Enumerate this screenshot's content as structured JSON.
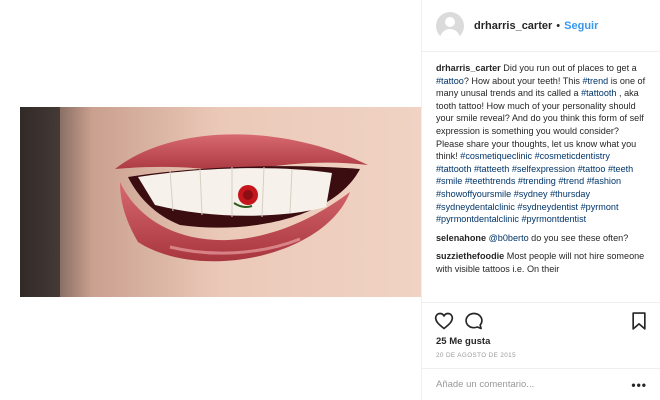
{
  "post": {
    "author": "drharris_carter",
    "separator": "•",
    "follow_label": "Seguir",
    "likes": "25 Me gusta",
    "date": "20 DE AGOSTO DE 2015",
    "comment_placeholder": "Añade un comentario...",
    "more_label": "•••"
  },
  "caption": {
    "user": "drharris_carter",
    "segments": [
      {
        "text": "Did you run out of places to get a ",
        "tag": false
      },
      {
        "text": "#tattoo",
        "tag": true
      },
      {
        "text": "? How about your teeth! This ",
        "tag": false
      },
      {
        "text": "#trend",
        "tag": true
      },
      {
        "text": " is one of many unusal trends and its called a ",
        "tag": false
      },
      {
        "text": "#tattooth",
        "tag": true
      },
      {
        "text": " , aka tooth tattoo! How much of your personality should your smile reveal? And do you think this form of self expression is something you would consider? Please share your thoughts, let us know what you think! ",
        "tag": false
      },
      {
        "text": "#cosmetiqueclinic",
        "tag": true
      },
      {
        "text": " ",
        "tag": false
      },
      {
        "text": "#cosmeticdentistry",
        "tag": true
      },
      {
        "text": " ",
        "tag": false
      },
      {
        "text": "#tattooth",
        "tag": true
      },
      {
        "text": " ",
        "tag": false
      },
      {
        "text": "#tatteeth",
        "tag": true
      },
      {
        "text": " ",
        "tag": false
      },
      {
        "text": "#selfexpression",
        "tag": true
      },
      {
        "text": " ",
        "tag": false
      },
      {
        "text": "#tattoo",
        "tag": true
      },
      {
        "text": " ",
        "tag": false
      },
      {
        "text": "#teeth",
        "tag": true
      },
      {
        "text": " ",
        "tag": false
      },
      {
        "text": "#smile",
        "tag": true
      },
      {
        "text": " ",
        "tag": false
      },
      {
        "text": "#teethtrends",
        "tag": true
      },
      {
        "text": " ",
        "tag": false
      },
      {
        "text": "#trending",
        "tag": true
      },
      {
        "text": " ",
        "tag": false
      },
      {
        "text": "#trend",
        "tag": true
      },
      {
        "text": " ",
        "tag": false
      },
      {
        "text": "#fashion",
        "tag": true
      },
      {
        "text": " ",
        "tag": false
      },
      {
        "text": "#showoffyoursmile",
        "tag": true
      },
      {
        "text": " ",
        "tag": false
      },
      {
        "text": "#sydney",
        "tag": true
      },
      {
        "text": " ",
        "tag": false
      },
      {
        "text": "#thursday",
        "tag": true
      },
      {
        "text": " ",
        "tag": false
      },
      {
        "text": "#sydneydentalclinic",
        "tag": true
      },
      {
        "text": " ",
        "tag": false
      },
      {
        "text": "#sydneydentist",
        "tag": true
      },
      {
        "text": " ",
        "tag": false
      },
      {
        "text": "#pyrmont",
        "tag": true
      },
      {
        "text": " ",
        "tag": false
      },
      {
        "text": "#pyrmontdentalclinic",
        "tag": true
      },
      {
        "text": " ",
        "tag": false
      },
      {
        "text": "#pyrmontdentist",
        "tag": true
      }
    ]
  },
  "comments": [
    {
      "user": "selenahone",
      "segments": [
        {
          "text": "@b0berto",
          "tag": true
        },
        {
          "text": " do you see these often?",
          "tag": false
        }
      ]
    },
    {
      "user": "suzziethefoodie",
      "segments": [
        {
          "text": "Most people will not hire someone with visible tattoos i.e. On their",
          "tag": false
        }
      ]
    }
  ],
  "icons": {
    "like": "heart-icon",
    "comment": "comment-bubble-icon",
    "save": "bookmark-icon",
    "avatar": "default-avatar-icon"
  },
  "colors": {
    "link_blue": "#3897f0",
    "hashtag": "#003569",
    "text": "#262626",
    "muted": "#999999",
    "border": "#efefef"
  }
}
